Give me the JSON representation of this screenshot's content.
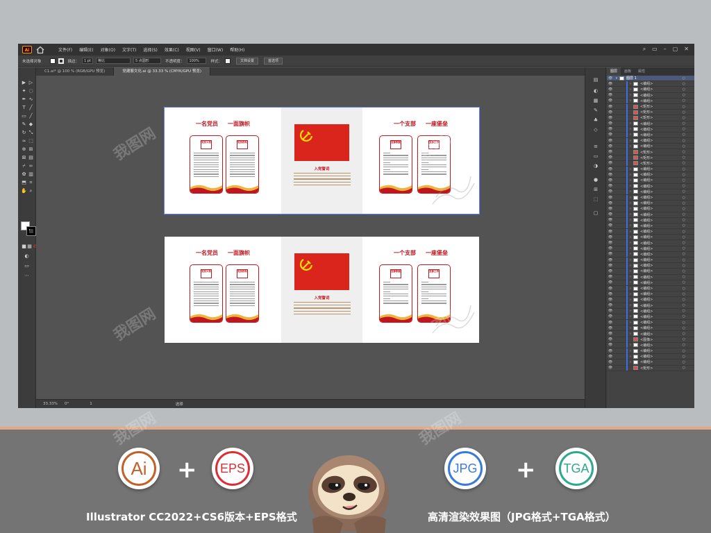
{
  "menubar": {
    "items": [
      "文件(F)",
      "编辑(E)",
      "对象(O)",
      "文字(T)",
      "选择(S)",
      "效果(C)",
      "视图(V)",
      "窗口(W)",
      "帮助(H)"
    ]
  },
  "controlbar": {
    "selection": "未选择对象",
    "stroke_label": "描边：",
    "stroke_value": "1 pt",
    "stroke_style": "等比",
    "brush": "5 点圆形",
    "opacity_label": "不透明度：",
    "opacity_value": "100%",
    "style_label": "样式：",
    "doc_setup": "文档设置",
    "prefs": "首选项"
  },
  "tabs": [
    {
      "label": "C1.ai* @ 100 % (RGB/GPU 预览)"
    },
    {
      "label": "党建展文化.ai @ 33.33 % (CMYK/GPU 预览)"
    }
  ],
  "statusbar": {
    "zoom": "33.33%",
    "rotation": "0°",
    "artboard": "1",
    "tool": "选择"
  },
  "layers_panel": {
    "tabs": [
      "图层",
      "画板",
      "属性"
    ],
    "top_layer": "图层 1",
    "rows": [
      "<编组>",
      "<编组>",
      "<编组>",
      "<编组>",
      "<矩形>",
      "<矩形>",
      "<矩形>",
      "<编组>",
      "<编组>",
      "<编组>",
      "<编组>",
      "<编组>",
      "<矩形>",
      "<矩形>",
      "<矩形>",
      "<编组>",
      "<编组>",
      "<编组>",
      "<编组>",
      "<编组>",
      "<编组>",
      "<编组>",
      "<编组>",
      "<编组>",
      "<编组>",
      "<编组>",
      "<编组>",
      "<编组>",
      "<编组>",
      "<编组>",
      "<编组>",
      "<编组>",
      "<编组>",
      "<编组>",
      "<编组>",
      "<编组>",
      "<编组>",
      "<编组>",
      "<编组>",
      "<编组>",
      "<编组>",
      "<编组>",
      "<编组>",
      "<编组>",
      "<编组>",
      "<图像>",
      "<编组>",
      "<编组>",
      "<编组>",
      "<编组>",
      "<矩形>"
    ]
  },
  "artboard": {
    "left_heading_1": "一名党员",
    "left_heading_2": "一面旗帜",
    "right_heading_1": "一个支部",
    "right_heading_2": "一座堡垒",
    "card_titles": [
      "党员义务",
      "党员权利",
      "支部职能",
      "支部工作"
    ],
    "oath_title": "入党誓词"
  },
  "promo": {
    "badge_ai": "Ai",
    "badge_eps": "EPS",
    "badge_jpg": "JPG",
    "badge_tga": "TGA",
    "plus": "+",
    "caption_left": "Illustrator CC2022+CS6版本+EPS格式",
    "caption_right": "高清渲染效果图（JPG格式+TGA格式）",
    "watermark": "我图网"
  },
  "colors": {
    "party_red": "#c0171f",
    "flag_red": "#da251d",
    "ai_orange": "#c0612b",
    "eps_red": "#d8303a",
    "jpg_blue": "#3b7bd8",
    "tga_green": "#2fa88e",
    "selection_blue": "#3d6fe0"
  }
}
